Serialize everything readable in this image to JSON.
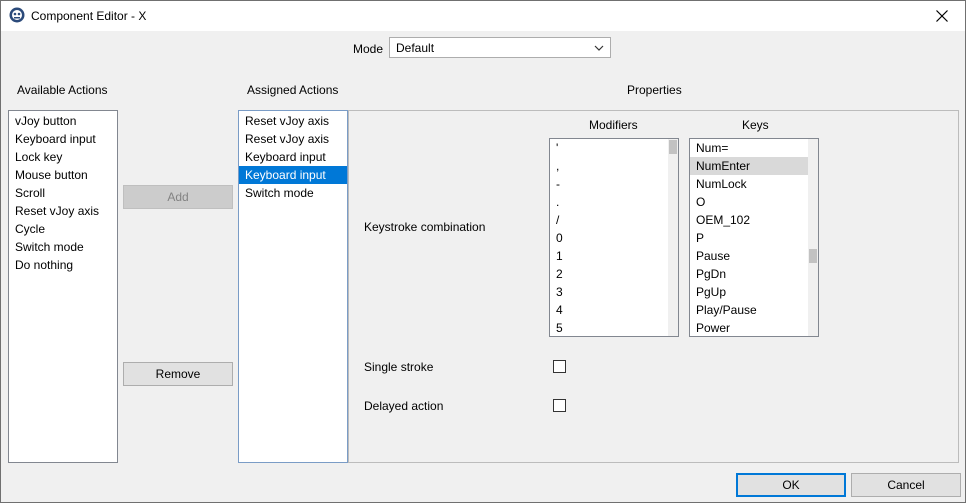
{
  "window": {
    "title": "Component Editor - X",
    "close_glyph": "✕"
  },
  "mode": {
    "label": "Mode",
    "value": "Default"
  },
  "available_actions": {
    "header": "Available Actions",
    "items": [
      "vJoy button",
      "Keyboard input",
      "Lock key",
      "Mouse button",
      "Scroll",
      "Reset vJoy axis",
      "Cycle",
      "Switch mode",
      "Do nothing"
    ]
  },
  "assigned_actions": {
    "header": "Assigned Actions",
    "items": [
      "Reset vJoy axis",
      "Reset vJoy axis",
      "Keyboard input",
      "Keyboard input",
      "Switch mode"
    ],
    "selected_index": 3
  },
  "buttons": {
    "add": "Add",
    "remove": "Remove",
    "ok": "OK",
    "cancel": "Cancel"
  },
  "properties": {
    "header": "Properties",
    "keystroke_label": "Keystroke combination",
    "modifiers": {
      "header": "Modifiers",
      "items": [
        "'",
        ",",
        "-",
        ".",
        "/",
        "0",
        "1",
        "2",
        "3",
        "4",
        "5"
      ]
    },
    "keys": {
      "header": "Keys",
      "items": [
        "Num=",
        "NumEnter",
        "NumLock",
        "O",
        "OEM_102",
        "P",
        "Pause",
        "PgDn",
        "PgUp",
        "Play/Pause",
        "Power"
      ],
      "highlighted_index": 1
    },
    "single_stroke": {
      "label": "Single stroke",
      "checked": false
    },
    "delayed_action": {
      "label": "Delayed action",
      "checked": false
    }
  },
  "colors": {
    "selection": "#0078d7",
    "highlight": "#d9d9d9"
  }
}
